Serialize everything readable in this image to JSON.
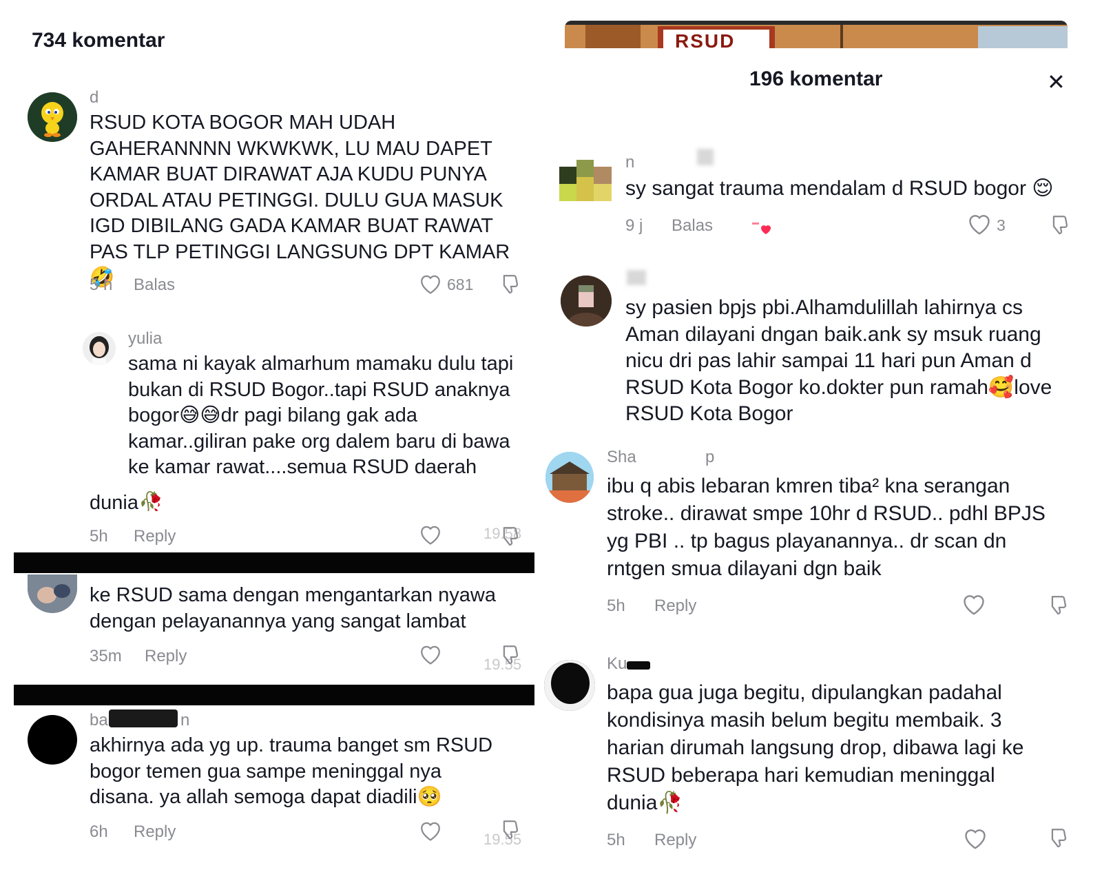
{
  "left": {
    "header_title": "734 komentar",
    "comments": [
      {
        "user": "d",
        "text": "RSUD KOTA BOGOR MAH UDAH\nGAHERANNNN WKWKWK, LU MAU DAPET\nKAMAR BUAT DIRAWAT AJA KUDU PUNYA\nORDAL ATAU PETINGGI. DULU GUA MASUK\nIGD DIBILANG GADA KAMAR BUAT RAWAT\nPAS TLP PETINGGI LANGSUNG DPT KAMAR🤣",
        "time": "5 h",
        "reply": "Balas",
        "likes": "681"
      },
      {
        "user": "yulia",
        "text": "sama ni kayak almarhum mamaku dulu tapi\nbukan di RSUD Bogor..tapi RSUD anaknya\nbogor😅😅dr pagi bilang gak ada\nkamar..giliran pake org dalem baru di bawa\nke kamar rawat....semua RSUD daerah",
        "tail": "dunia🥀",
        "time": "5h",
        "reply": "Reply",
        "clock": "19.58"
      },
      {
        "text": "ke RSUD sama dengan mengantarkan nyawa\ndengan pelayanannya yang sangat lambat",
        "time": "35m",
        "reply": "Reply",
        "clock": "19.55"
      },
      {
        "user_start": "ba",
        "user_end": "n",
        "text": "akhirnya ada yg up. trauma banget sm RSUD\nbogor temen gua sampe meninggal nya\ndisana. ya allah semoga dapat diadili🥺",
        "time": "6h",
        "reply": "Reply",
        "clock": "19.55"
      }
    ]
  },
  "right": {
    "banner_text": "RSUD",
    "header_title": "196 komentar",
    "close_label": "✕",
    "comments": [
      {
        "user": "n",
        "text": "sy sangat trauma mendalam d RSUD bogor 😌",
        "time": "9 j",
        "reply": "Balas",
        "likes": "3"
      },
      {
        "text": "sy pasien bpjs pbi.Alhamdulillah lahirnya cs\nAman dilayani dngan baik.ank sy msuk ruang\nnicu dri pas lahir sampai 11 hari pun Aman d\nRSUD Kota Bogor ko.dokter pun ramah🥰love\nRSUD Kota Bogor"
      },
      {
        "user_start": "Sha",
        "user_end": "p",
        "text": "ibu q abis lebaran kmren tiba² kna serangan\nstroke.. dirawat smpe 10hr d RSUD.. pdhl BPJS\nyg PBI .. tp bagus playanannya.. dr scan dn\nrntgen smua dilayani dgn baik",
        "time": "5h",
        "reply": "Reply"
      },
      {
        "user_start": "Ku",
        "text": "bapa gua juga begitu, dipulangkan padahal\nkondisinya masih belum begitu membaik. 3\nharian dirumah langsung drop, dibawa lagi ke\nRSUD beberapa hari kemudian meninggal\ndunia🥀",
        "time": "5h",
        "reply": "Reply"
      }
    ]
  },
  "colors": {
    "text": "#161823",
    "secondary": "#8a8b91",
    "heart_red": "#fe2c55",
    "bar": "#050505"
  }
}
